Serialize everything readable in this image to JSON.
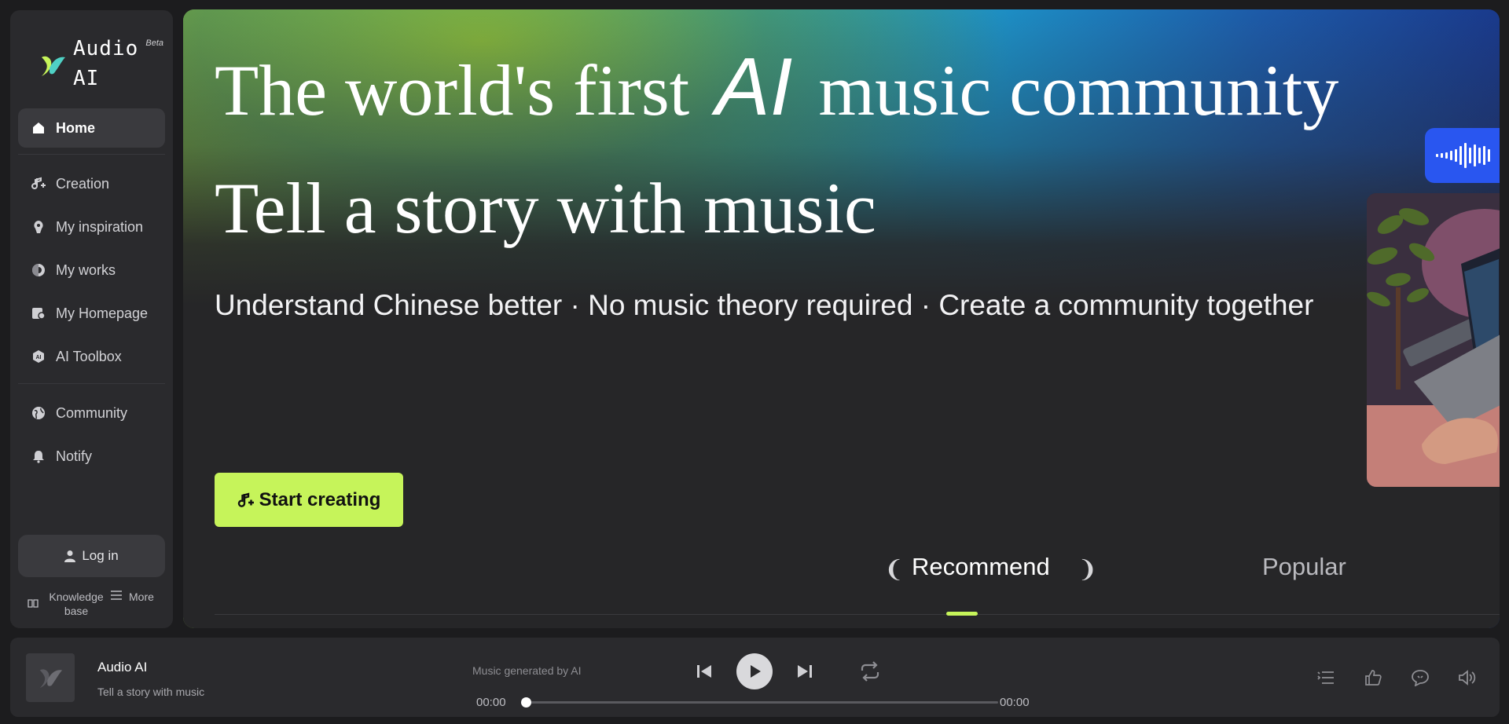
{
  "app": {
    "logo_line1": "Audio",
    "logo_line2": "AI",
    "beta": "Beta"
  },
  "sidebar": {
    "items": [
      {
        "label": "Home",
        "icon": "home-icon"
      },
      {
        "label": "Creation",
        "icon": "music-plus-icon"
      },
      {
        "label": "My inspiration",
        "icon": "lightbulb-icon"
      },
      {
        "label": "My works",
        "icon": "disc-icon"
      },
      {
        "label": "My Homepage",
        "icon": "profile-icon"
      },
      {
        "label": "AI Toolbox",
        "icon": "ai-hexagon-icon"
      },
      {
        "label": "Community",
        "icon": "globe-icon"
      },
      {
        "label": "Notify",
        "icon": "bell-icon"
      }
    ],
    "login": "Log in",
    "knowledge_base": "Knowledge base",
    "more": "More"
  },
  "hero": {
    "headline_pre": "The world's first",
    "headline_ai": "AI",
    "headline_post": "music community",
    "headline2": "Tell a story with music",
    "subtitle": "Understand Chinese better · No music theory required · Create a community together",
    "cta": "Start creating"
  },
  "tabs": {
    "recommend": "Recommend",
    "popular": "Popular"
  },
  "player": {
    "title": "Audio AI",
    "subtitle": "Tell a story with music",
    "generated": "Music generated by AI",
    "time_current": "00:00",
    "time_total": "00:00",
    "progress": 0
  },
  "colors": {
    "accent": "#c6f45a",
    "wave_card": "#2956f0"
  }
}
